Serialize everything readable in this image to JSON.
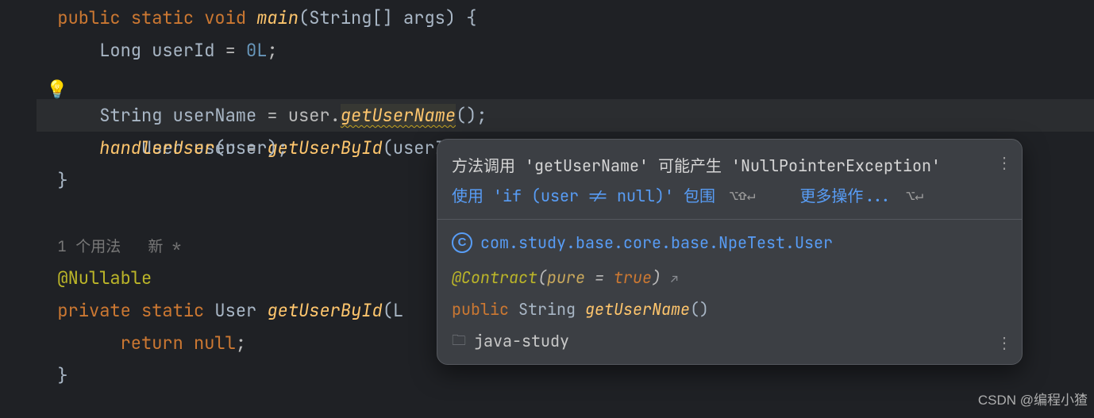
{
  "code": {
    "l1": {
      "kw1": "public",
      "kw2": "static",
      "kw3": "void",
      "method": "main",
      "sig_open": "(String[] args) {"
    },
    "l2": {
      "type": "Long",
      "ident": "userId",
      "op": " = ",
      "num": "0L",
      "semi": ";"
    },
    "l3": {
      "type": "User",
      "ident": "user",
      "op": " = ",
      "call": "getUserById",
      "args": "(userId);"
    },
    "l4": {
      "type": "String",
      "ident": "userName",
      "op": " = user.",
      "call": "getUserName",
      "args": "();"
    },
    "l5": {
      "call": "handlerUser",
      "args": "(user);"
    },
    "l6": {
      "brace": "}"
    },
    "l8_hints": "1 个用法   新 *",
    "l9": {
      "ann": "@Nullable"
    },
    "l10": {
      "kw1": "private",
      "kw2": "static",
      "type": "User",
      "method": "getUserById",
      "sig_open": "(L"
    },
    "l11": {
      "kw": "return",
      "val": "null",
      "semi": ";"
    },
    "l12": {
      "brace": "}"
    }
  },
  "tooltip": {
    "warning": "方法调用 'getUserName' 可能产生 'NullPointerException'",
    "action1": "使用 'if (user != null)' 包围",
    "kb1": "⌥⇧↵",
    "more": "更多操作...",
    "kb2": "⌥↵",
    "class_path": "com.study.base.core.base.NpeTest.User",
    "contract_ann": "@Contract",
    "contract_args_open": "(",
    "contract_k": "pure",
    "contract_eq": " = ",
    "contract_v": "true",
    "contract_args_close": ") ",
    "arrow": "↗",
    "sig_kw": "public",
    "sig_type": "String",
    "sig_method": "getUserName",
    "sig_rest": "()",
    "module": "java-study"
  },
  "watermark": "CSDN @编程小猹"
}
